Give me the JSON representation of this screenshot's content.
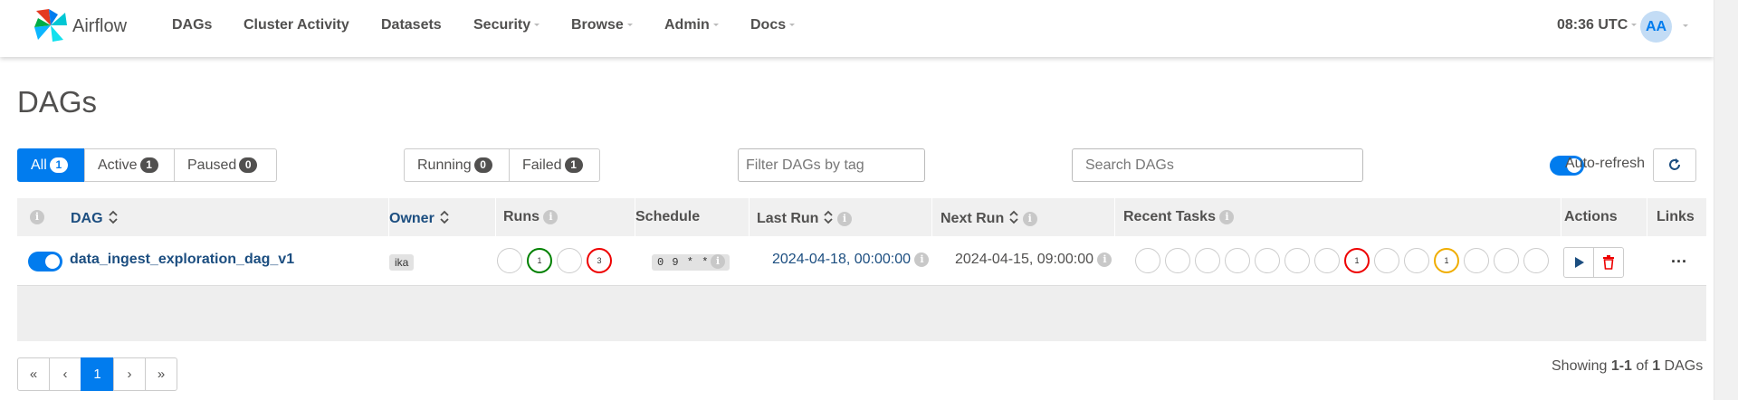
{
  "brand": {
    "name": "Airflow"
  },
  "nav": {
    "items": [
      {
        "label": "DAGs",
        "dropdown": false
      },
      {
        "label": "Cluster Activity",
        "dropdown": false
      },
      {
        "label": "Datasets",
        "dropdown": false
      },
      {
        "label": "Security",
        "dropdown": true
      },
      {
        "label": "Browse",
        "dropdown": true
      },
      {
        "label": "Admin",
        "dropdown": true
      },
      {
        "label": "Docs",
        "dropdown": true
      }
    ],
    "clock": "08:36 UTC",
    "user_initials": "AA"
  },
  "page_title": "DAGs",
  "filters": {
    "status": [
      {
        "label": "All",
        "count": "1",
        "active": true
      },
      {
        "label": "Active",
        "count": "1",
        "active": false
      },
      {
        "label": "Paused",
        "count": "0",
        "active": false
      }
    ],
    "runs": [
      {
        "label": "Running",
        "count": "0"
      },
      {
        "label": "Failed",
        "count": "1"
      }
    ],
    "tag_placeholder": "Filter DAGs by tag",
    "search_placeholder": "Search DAGs",
    "auto_refresh_label": "Auto-refresh",
    "auto_refresh_on": true
  },
  "table": {
    "headers": {
      "dag": "DAG",
      "owner": "Owner",
      "runs": "Runs",
      "schedule": "Schedule",
      "last_run": "Last Run",
      "next_run": "Next Run",
      "recent_tasks": "Recent Tasks",
      "actions": "Actions",
      "links": "Links"
    },
    "rows": [
      {
        "dag_id": "data_ingest_exploration_dag_v1",
        "enabled": true,
        "owner": "ika",
        "runs": [
          "",
          "1",
          "",
          "3"
        ],
        "schedule": "0 9 * * 1",
        "last_run": "2024-04-18, 00:00:00",
        "next_run": "2024-04-15, 09:00:00",
        "recent_tasks": [
          "",
          "",
          "",
          "",
          "",
          "",
          "",
          "1",
          "",
          "",
          "1",
          "",
          "",
          ""
        ],
        "links": "..."
      }
    ]
  },
  "pagination": {
    "first": "«",
    "prev": "‹",
    "current": "1",
    "next": "›",
    "last": "»",
    "showing_prefix": "Showing ",
    "showing_range": "1-1",
    "showing_of": " of ",
    "showing_total": "1",
    "showing_suffix": " DAGs"
  },
  "colors": {
    "primary": "#017cee",
    "success": "#008000",
    "failed": "#e00000",
    "upstream_failed": "#f0ad00"
  }
}
